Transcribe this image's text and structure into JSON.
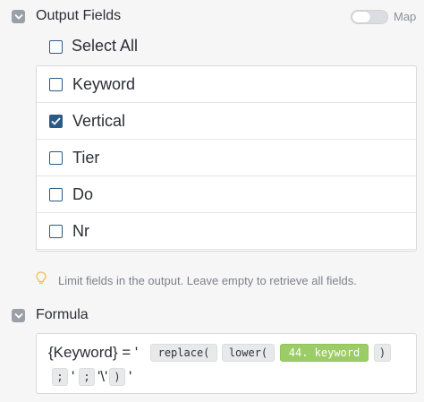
{
  "output_fields": {
    "title": "Output Fields",
    "map_label": "Map",
    "select_all_label": "Select All",
    "items": [
      {
        "label": "Keyword",
        "checked": false
      },
      {
        "label": "Vertical",
        "checked": true
      },
      {
        "label": "Tier",
        "checked": false
      },
      {
        "label": "Do",
        "checked": false
      },
      {
        "label": "Nr",
        "checked": false
      }
    ],
    "hint": "Limit fields in the output. Leave empty to retrieve all fields."
  },
  "formula": {
    "title": "Formula",
    "prefix": "{Keyword} = '",
    "fn_replace": "replace(",
    "fn_lower": "lower(",
    "var_keyword": "44. keyword",
    "close_paren_1": ")",
    "semi_1": ";",
    "quote_1": "'",
    "semi_2": ";",
    "quote_backslash": "'\\'",
    "close_paren_2": ")",
    "suffix": "'"
  },
  "colors": {
    "checkbox_accent": "#2b5a86",
    "variable_pill": "#9ccc65"
  },
  "icons": {
    "collapse": "chevron-down-icon",
    "hint": "lightbulb-icon",
    "check": "checkmark-icon"
  }
}
